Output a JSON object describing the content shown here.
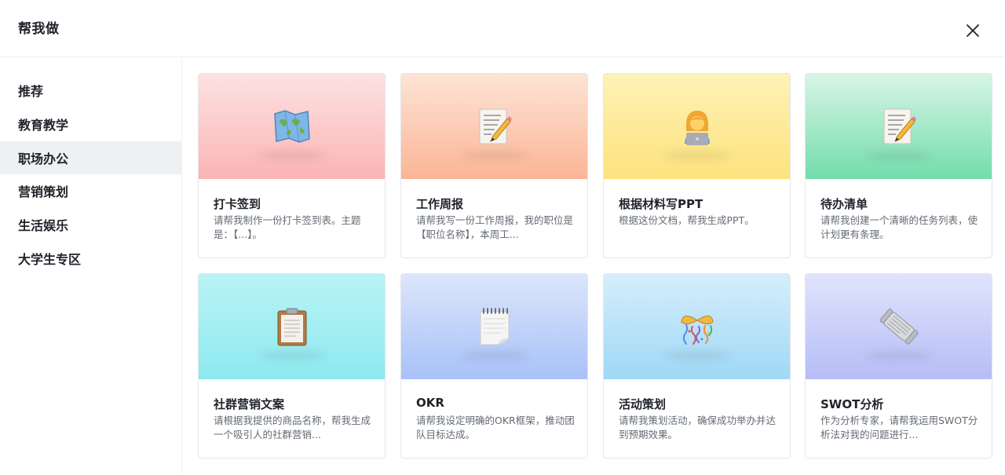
{
  "header": {
    "title": "帮我做"
  },
  "sidebar": {
    "items": [
      {
        "label": "推荐"
      },
      {
        "label": "教育教学"
      },
      {
        "label": "职场办公"
      },
      {
        "label": "营销策划"
      },
      {
        "label": "生活娱乐"
      },
      {
        "label": "大学生专区"
      }
    ],
    "active": "职场办公"
  },
  "cards": [
    {
      "title": "打卡签到",
      "desc": "请帮我制作一份打卡签到表。主题是：【...】。",
      "icon": "world-map-icon",
      "color": "#fbb4b4"
    },
    {
      "title": "工作周报",
      "desc": "请帮我写一份工作周报，我的职位是【职位名称】，本周工...",
      "icon": "memo-pencil-icon",
      "color": "#fbb596"
    },
    {
      "title": "根据材料写PPT",
      "desc": "根据这份文档，帮我生成PPT。",
      "icon": "woman-laptop-icon",
      "color": "#fde37c"
    },
    {
      "title": "待办清单",
      "desc": "请帮我创建一个清晰的任务列表，使计划更有条理。",
      "icon": "memo-pencil-icon",
      "color": "#73dcab"
    },
    {
      "title": "社群营销文案",
      "desc": "请根据我提供的商品名称，帮我生成一个吸引人的社群营销...",
      "icon": "clipboard-icon",
      "color": "#8de9ef"
    },
    {
      "title": "OKR",
      "desc": "请帮我设定明确的OKR框架，推动团队目标达成。",
      "icon": "spiral-notepad-icon",
      "color": "#a8c1f8"
    },
    {
      "title": "活动策划",
      "desc": "请帮我策划活动，确保成功举办并达到预期效果。",
      "icon": "confetti-ball-icon",
      "color": "#9fd8f6"
    },
    {
      "title": "SWOT分析",
      "desc": "作为分析专家，请帮我运用SWOT分析法对我的问题进行...",
      "icon": "rolled-newspaper-icon",
      "color": "#b6bdf6"
    }
  ]
}
